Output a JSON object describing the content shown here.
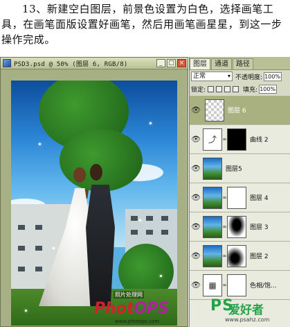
{
  "instruction": "13、新建空白图层，前景色设置为白色，选择画笔工具，在画笔面版设置好画笔，然后用画笔画星星，到这一步操作完成。",
  "document": {
    "title": "PSD3.psd @ 50% (图层 6, RGB/8)",
    "buttons": {
      "minimize": "_",
      "maximize": "□",
      "close": "×"
    }
  },
  "canvas_watermark": {
    "brand_a": "Phot",
    "brand_b": "OPS",
    "cn": "照片处理网",
    "url": "www.photops.com"
  },
  "panel": {
    "tabs": [
      "图层",
      "通道",
      "路径"
    ],
    "blend_mode": "正常",
    "opacity_label": "不透明度:",
    "opacity_value": "100%",
    "lock_label": "锁定:",
    "fill_label": "填充:",
    "fill_value": "100%"
  },
  "layers": [
    {
      "name": "图层 6",
      "thumb": "transparent",
      "mask": null,
      "selected": true
    },
    {
      "name": "曲线 2",
      "thumb": "adjustment",
      "mask": "black",
      "selected": false
    },
    {
      "name": "图层5",
      "thumb": "photo",
      "mask": null,
      "selected": false
    },
    {
      "name": "图层 4",
      "thumb": "photo",
      "mask": "white",
      "selected": false
    },
    {
      "name": "图层 3",
      "thumb": "photo",
      "mask": "figure",
      "selected": false
    },
    {
      "name": "图层 2",
      "thumb": "photo",
      "mask": "figure",
      "selected": false
    },
    {
      "name": "色相/饱...",
      "thumb": "adjustment",
      "mask": "white",
      "selected": false
    }
  ],
  "site_badge": {
    "latin": "PS",
    "cn": "爱好者",
    "url": "www.psahz.com"
  }
}
